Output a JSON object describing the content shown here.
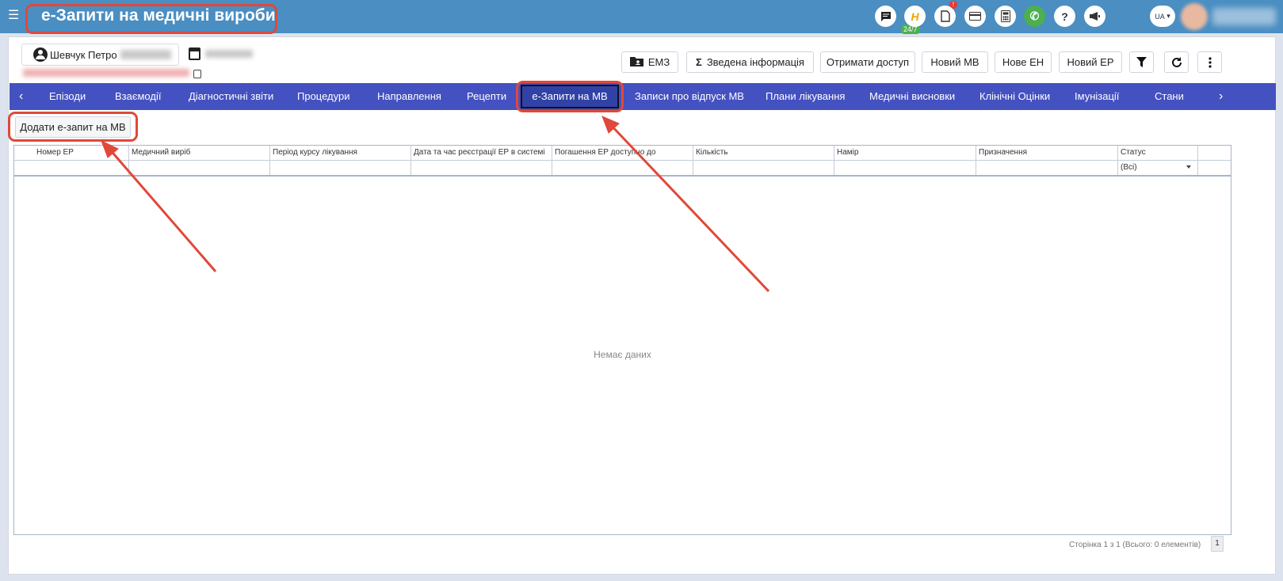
{
  "header": {
    "menu_icon": "☰",
    "title": "е-Запити на медичні вироби",
    "chat_badge": "24/7",
    "notification_badge": "!",
    "lang": "UA",
    "icons": [
      "chat-icon",
      "h-logo-icon",
      "pdf-icon",
      "card-icon",
      "calculator-icon",
      "phone-icon",
      "help-icon",
      "megaphone-icon"
    ]
  },
  "patient": {
    "name": "Шевчук Петро"
  },
  "actions": {
    "emz": "ЕМЗ",
    "summary": "Зведена інформація",
    "get_access": "Отримати доступ",
    "new_mv": "Новий МВ",
    "new_eh": "Нове ЕН",
    "new_er": "Новий ЕР"
  },
  "tabs": [
    "Епізоди",
    "Взаємодії",
    "Діагностичні звіти",
    "Процедури",
    "Направлення",
    "Рецепти",
    "е-Запити на МВ",
    "Записи про відпуск МВ",
    "Плани лікування",
    "Медичні висновки",
    "Клінічні Оцінки",
    "Імунізації",
    "Стани"
  ],
  "active_tab": "е-Запити на МВ",
  "add_button": "Додати е-запит на МВ",
  "grid": {
    "columns": [
      "Номер ЕР",
      "Медичний виріб",
      "Період курсу лікування",
      "Дата та час реєстрації ЕР в системі",
      "Погашення ЕР доступно до",
      "Кількість",
      "Намір",
      "Призначення",
      "Статус"
    ],
    "status_filter": "(Всі)",
    "empty_text": "Немає даних",
    "pager_text": "Сторінка 1 з 1 (Всього: 0 елементів)",
    "page": "1"
  },
  "colors": {
    "topbar": "#4a8ec2",
    "tabs": "#4451c0",
    "highlight": "#e0483a"
  }
}
